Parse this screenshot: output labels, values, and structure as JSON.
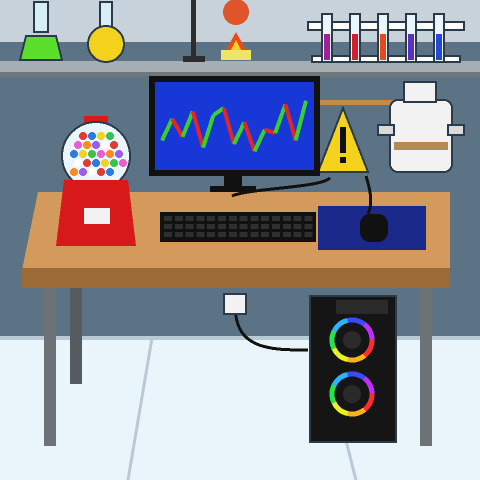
{
  "scene": {
    "description_name": "lab-desk-scene"
  },
  "colors": {
    "wall": "#5c7285",
    "wall_dark": "#4f6476",
    "floor": "#eaf4fb",
    "floor_line": "#b9c9d6",
    "shelf": "#a7aeb3",
    "shelf_dark": "#6f767b",
    "desk_top": "#d39a5c",
    "desk_edge": "#9c6a37",
    "desk_leg": "#6d7276",
    "monitor_frame": "#111111",
    "monitor_screen": "#1737d6",
    "graph_green": "#38d12a",
    "graph_red": "#e0262b",
    "gumball_red": "#d81919",
    "warning_yellow": "#f5d21b",
    "mousepad": "#1b2a8a",
    "pc_case": "#151515"
  },
  "monitor_graph": {
    "points": [
      0.7,
      0.4,
      0.65,
      0.3,
      0.8,
      0.35,
      0.25,
      0.75,
      0.45,
      0.85,
      0.55,
      0.6,
      0.2,
      0.7,
      0.15
    ]
  },
  "test_tubes": [
    {
      "liquid": "#a11f9c"
    },
    {
      "liquid": "#d2202a"
    },
    {
      "liquid": "#e24a1b"
    },
    {
      "liquid": "#5a2fc1"
    },
    {
      "liquid": "#2347d8"
    }
  ],
  "gumball_colors": [
    "#e23b2f",
    "#2d7be0",
    "#f4d125",
    "#3cc24a",
    "#e85fd1",
    "#ff8a1e",
    "#9b5cf0",
    "#ffffff"
  ],
  "fan_ring_colors": [
    "#ff2d2d",
    "#ffb21c",
    "#e9f21c",
    "#2de04a",
    "#2bb3ff",
    "#3a4bff",
    "#c02dff"
  ]
}
